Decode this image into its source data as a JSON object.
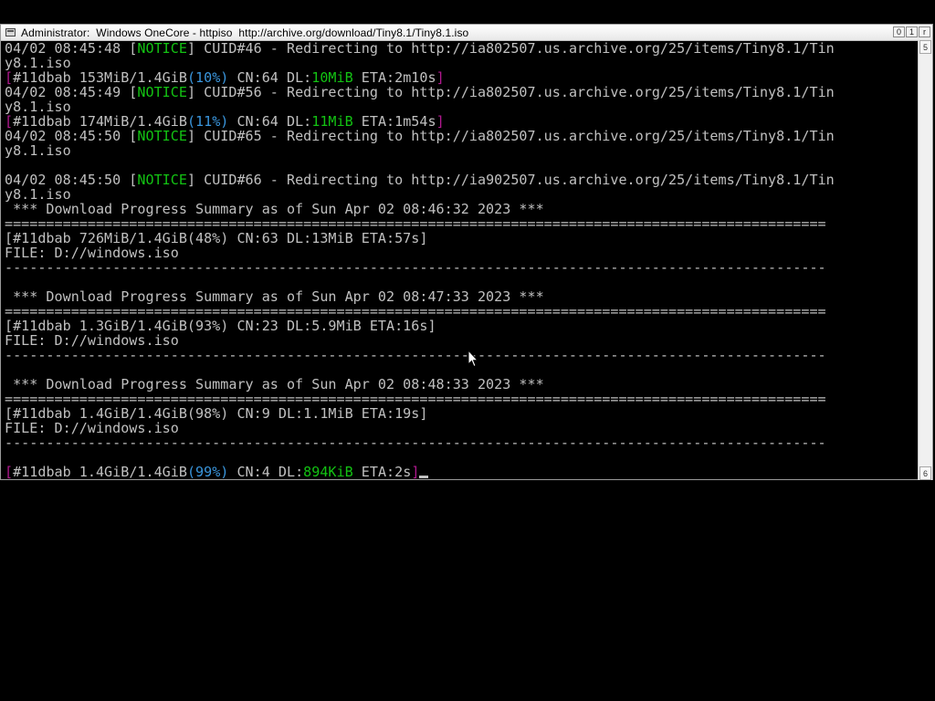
{
  "window": {
    "title": "Administrator:  Windows OneCore - httpiso  http://archive.org/download/Tiny8.1/Tiny8.1.iso",
    "buttons": {
      "minimize": "0",
      "maximize": "1",
      "close": "r"
    }
  },
  "scrollbar": {
    "up": "5",
    "down": "6"
  },
  "console": {
    "l1": {
      "a": "04/02 08:45:48 [",
      "notice": "NOTICE",
      "b": "] CUID#46 - Redirecting to http://ia802507.us.archive.org/25/items/Tiny8.1/Tin"
    },
    "l2": "y8.1.iso",
    "l3": {
      "a": "[",
      "b": "#11dbab 153MiB/1.4GiB",
      "pct": "(10%)",
      "c": " CN:64 DL:",
      "dl": "10MiB",
      "d": " ETA:2m10s",
      "e": "]"
    },
    "l4": {
      "a": "04/02 08:45:49 [",
      "notice": "NOTICE",
      "b": "] CUID#56 - Redirecting to http://ia802507.us.archive.org/25/items/Tiny8.1/Tin"
    },
    "l5": "y8.1.iso",
    "l6": {
      "a": "[",
      "b": "#11dbab 174MiB/1.4GiB",
      "pct": "(11%)",
      "c": " CN:64 DL:",
      "dl": "11MiB",
      "d": " ETA:1m54s",
      "e": "]"
    },
    "l7": {
      "a": "04/02 08:45:50 [",
      "notice": "NOTICE",
      "b": "] CUID#65 - Redirecting to http://ia802507.us.archive.org/25/items/Tiny8.1/Tin"
    },
    "l8": "y8.1.iso",
    "l10": {
      "a": "04/02 08:45:50 [",
      "notice": "NOTICE",
      "b": "] CUID#66 - Redirecting to http://ia902507.us.archive.org/25/items/Tiny8.1/Tin"
    },
    "l11": "y8.1.iso",
    "l12": " *** Download Progress Summary as of Sun Apr 02 08:46:32 2023 ***",
    "l13": "===================================================================================================",
    "l14": "[#11dbab 726MiB/1.4GiB(48%) CN:63 DL:13MiB ETA:57s]",
    "l15": "FILE: D://windows.iso",
    "l16": "---------------------------------------------------------------------------------------------------",
    "l18": " *** Download Progress Summary as of Sun Apr 02 08:47:33 2023 ***",
    "l19": "===================================================================================================",
    "l20": "[#11dbab 1.3GiB/1.4GiB(93%) CN:23 DL:5.9MiB ETA:16s]",
    "l21": "FILE: D://windows.iso",
    "l22": "---------------------------------------------------------------------------------------------------",
    "l24": " *** Download Progress Summary as of Sun Apr 02 08:48:33 2023 ***",
    "l25": "===================================================================================================",
    "l26": "[#11dbab 1.4GiB/1.4GiB(98%) CN:9 DL:1.1MiB ETA:19s]",
    "l27": "FILE: D://windows.iso",
    "l28": "---------------------------------------------------------------------------------------------------",
    "l30": {
      "a": "[",
      "b": "#11dbab 1.4GiB/1.4GiB",
      "pct": "(99%)",
      "c": " CN:4 DL:",
      "dl": "894KiB",
      "d": " ETA:2s",
      "e": "]"
    }
  },
  "colors": {
    "background": "#000000",
    "text": "#c0c0c0",
    "notice": "#13c313",
    "percent": "#3a96dd",
    "bracket": "#b1188f",
    "titlebar": "#ffffff"
  },
  "icons": [
    "console-app-icon",
    "mouse-pointer-icon"
  ]
}
